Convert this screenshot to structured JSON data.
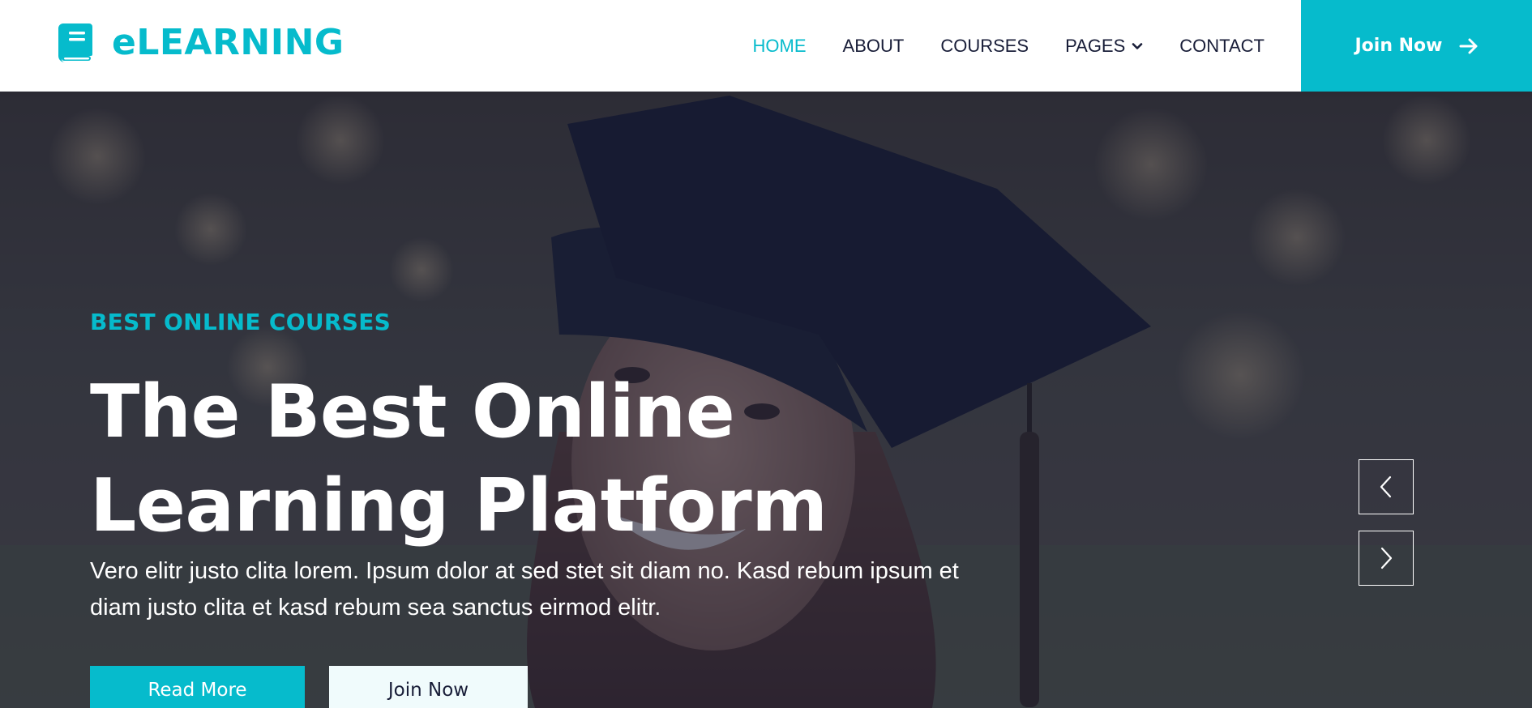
{
  "brand": {
    "name": "eLEARNING",
    "icon": "book-icon",
    "color": "#06BBCC"
  },
  "nav": {
    "items": [
      {
        "label": "HOME",
        "active": true
      },
      {
        "label": "ABOUT",
        "active": false
      },
      {
        "label": "COURSES",
        "active": false
      },
      {
        "label": "PAGES",
        "active": false,
        "has_dropdown": true
      },
      {
        "label": "CONTACT",
        "active": false
      }
    ],
    "cta": {
      "label": "Join Now",
      "icon": "arrow-right-icon"
    }
  },
  "hero": {
    "eyebrow": "BEST ONLINE COURSES",
    "title_line1": "The Best Online",
    "title_line2": "Learning Platform",
    "description": "Vero elitr justo clita lorem. Ipsum dolor at sed stet sit diam no. Kasd rebum ipsum et diam justo clita et kasd rebum sea sanctus eirmod elitr.",
    "primary_button": "Read More",
    "secondary_button": "Join Now",
    "carousel": {
      "prev_icon": "chevron-left-icon",
      "next_icon": "chevron-right-icon"
    }
  },
  "colors": {
    "accent": "#06BBCC",
    "dark": "#181d38",
    "light": "#F0FBFC"
  }
}
